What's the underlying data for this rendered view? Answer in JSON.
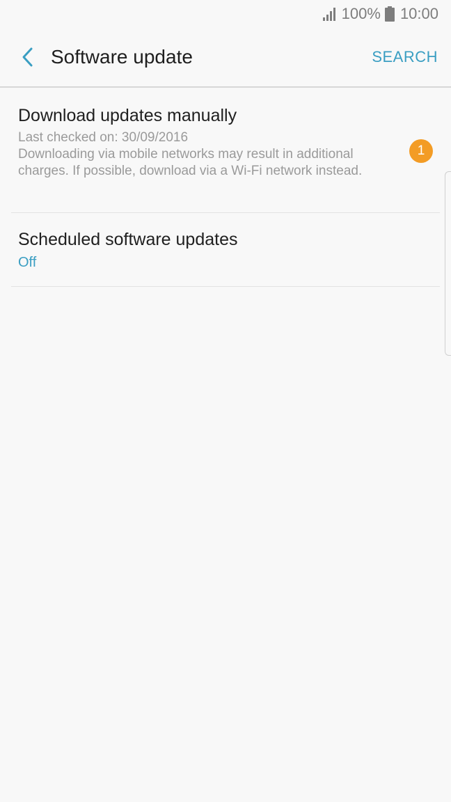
{
  "status_bar": {
    "battery_text": "100%",
    "clock": "10:00",
    "signal_icon": "signal-icon",
    "battery_icon": "battery-icon"
  },
  "app_bar": {
    "back_icon": "chevron-left-icon",
    "title": "Software update",
    "search_label": "SEARCH"
  },
  "colors": {
    "accent": "#3a9ec2",
    "badge": "#f39c25",
    "background": "#f8f8f8"
  },
  "items": [
    {
      "title": "Download updates manually",
      "last_checked": "Last checked on: 30/09/2016",
      "warning": "Downloading via mobile networks may result in additional charges. If possible, download via a Wi-Fi network instead.",
      "badge": "1"
    },
    {
      "title": "Scheduled software updates",
      "status": "Off"
    }
  ]
}
